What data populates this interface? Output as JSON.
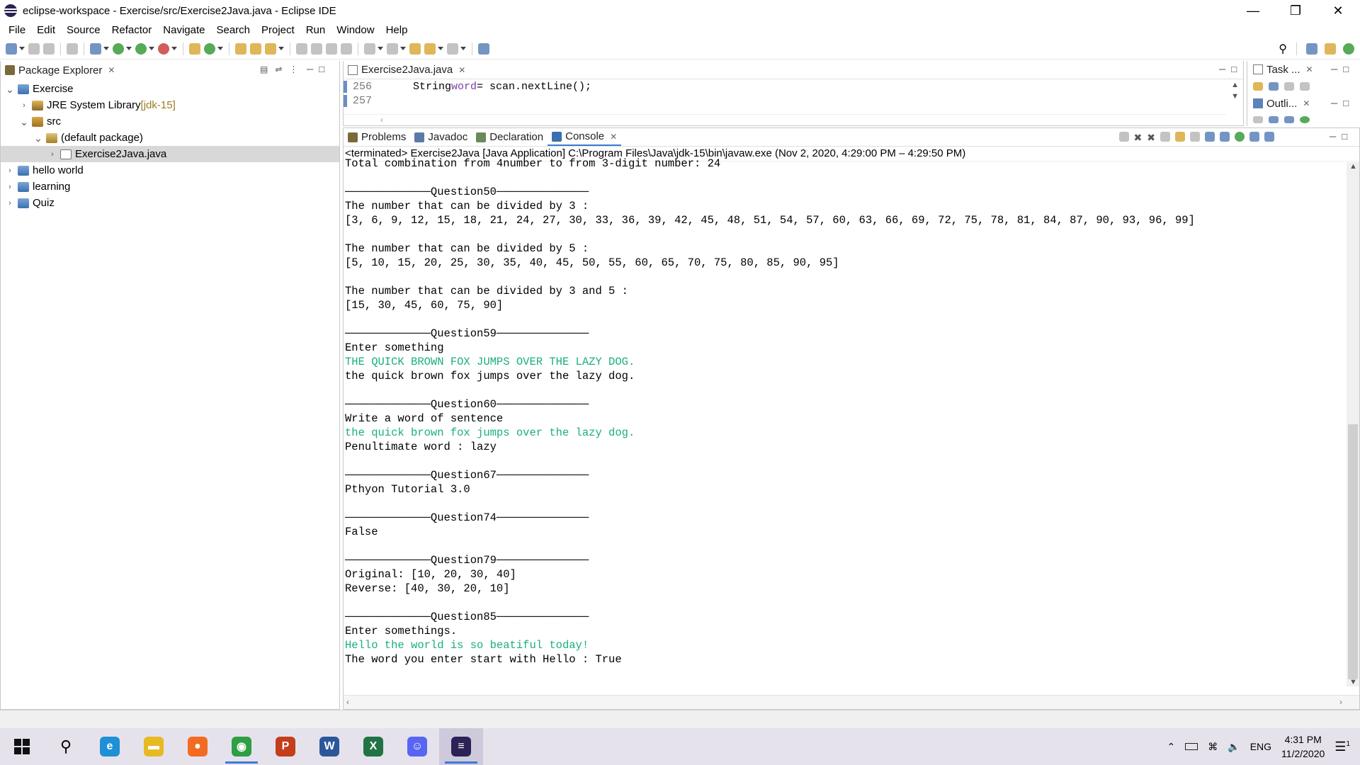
{
  "window": {
    "title": "eclipse-workspace - Exercise/src/Exercise2Java.java - Eclipse IDE"
  },
  "menu": [
    "File",
    "Edit",
    "Source",
    "Refactor",
    "Navigate",
    "Search",
    "Project",
    "Run",
    "Window",
    "Help"
  ],
  "package_explorer": {
    "tab_label": "Package Explorer",
    "nodes": [
      {
        "label": "Exercise",
        "suffix": "",
        "icon": "project-icon",
        "level": 0,
        "expanded": true
      },
      {
        "label": "JRE System Library ",
        "suffix": "[jdk-15]",
        "icon": "library-icon",
        "level": 1,
        "expanded": false
      },
      {
        "label": "src",
        "suffix": "",
        "icon": "source-folder-icon",
        "level": 1,
        "expanded": true
      },
      {
        "label": "(default package)",
        "suffix": "",
        "icon": "package-icon",
        "level": 2,
        "expanded": true
      },
      {
        "label": "Exercise2Java.java",
        "suffix": "",
        "icon": "java-file-icon",
        "level": 3,
        "expanded": false,
        "selected": true
      },
      {
        "label": "hello world",
        "suffix": "",
        "icon": "project-icon",
        "level": 0,
        "expanded": false
      },
      {
        "label": "learning",
        "suffix": "",
        "icon": "project-icon",
        "level": 0,
        "expanded": false
      },
      {
        "label": "Quiz",
        "suffix": "",
        "icon": "project-icon",
        "level": 0,
        "expanded": false
      }
    ]
  },
  "editor": {
    "tab_label": "Exercise2Java.java",
    "lines": [
      {
        "num": "256",
        "type": "String",
        "var": "word",
        "rest": " = scan.nextLine();"
      },
      {
        "num": "257",
        "type": "",
        "var": "",
        "rest": ""
      }
    ]
  },
  "side_views": {
    "task_label": "Task ...",
    "outline_label": "Outli..."
  },
  "bottom_tabs": [
    "Problems",
    "Javadoc",
    "Declaration",
    "Console"
  ],
  "console": {
    "info": "<terminated> Exercise2Java [Java Application] C:\\Program Files\\Java\\jdk-15\\bin\\javaw.exe  (Nov 2, 2020, 4:29:00 PM – 4:29:50 PM)",
    "lines": [
      {
        "t": "Total combination from 4number to from 3-digit number: 24",
        "in": false
      },
      {
        "t": "",
        "in": false
      },
      {
        "t": "─────────────Question50──────────────",
        "in": false
      },
      {
        "t": "The number that can be divided by 3 :",
        "in": false
      },
      {
        "t": "[3, 6, 9, 12, 15, 18, 21, 24, 27, 30, 33, 36, 39, 42, 45, 48, 51, 54, 57, 60, 63, 66, 69, 72, 75, 78, 81, 84, 87, 90, 93, 96, 99]",
        "in": false
      },
      {
        "t": "",
        "in": false
      },
      {
        "t": "The number that can be divided by 5 :",
        "in": false
      },
      {
        "t": "[5, 10, 15, 20, 25, 30, 35, 40, 45, 50, 55, 60, 65, 70, 75, 80, 85, 90, 95]",
        "in": false
      },
      {
        "t": "",
        "in": false
      },
      {
        "t": "The number that can be divided by 3 and 5 :",
        "in": false
      },
      {
        "t": "[15, 30, 45, 60, 75, 90]",
        "in": false
      },
      {
        "t": "",
        "in": false
      },
      {
        "t": "─────────────Question59──────────────",
        "in": false
      },
      {
        "t": "Enter something",
        "in": false
      },
      {
        "t": "THE QUICK BROWN FOX JUMPS OVER THE LAZY DOG.",
        "in": true
      },
      {
        "t": "the quick brown fox jumps over the lazy dog.",
        "in": false
      },
      {
        "t": "",
        "in": false
      },
      {
        "t": "─────────────Question60──────────────",
        "in": false
      },
      {
        "t": "Write a word of sentence",
        "in": false
      },
      {
        "t": "the quick brown fox jumps over the lazy dog.",
        "in": true
      },
      {
        "t": "Penultimate word : lazy",
        "in": false
      },
      {
        "t": "",
        "in": false
      },
      {
        "t": "─────────────Question67──────────────",
        "in": false
      },
      {
        "t": "Pthyon Tutorial 3.0",
        "in": false
      },
      {
        "t": "",
        "in": false
      },
      {
        "t": "─────────────Question74──────────────",
        "in": false
      },
      {
        "t": "False",
        "in": false
      },
      {
        "t": "",
        "in": false
      },
      {
        "t": "─────────────Question79──────────────",
        "in": false
      },
      {
        "t": "Original: [10, 20, 30, 40]",
        "in": false
      },
      {
        "t": "Reverse: [40, 30, 20, 10]",
        "in": false
      },
      {
        "t": "",
        "in": false
      },
      {
        "t": "─────────────Question85──────────────",
        "in": false
      },
      {
        "t": "Enter somethings.",
        "in": false
      },
      {
        "t": "Hello the world is so beatiful today!",
        "in": true
      },
      {
        "t": "The word you enter start with Hello : True",
        "in": false
      }
    ]
  },
  "taskbar": {
    "apps": [
      {
        "name": "edge-icon",
        "glyph": "e",
        "color": "#1f8fd6",
        "running": false
      },
      {
        "name": "file-explorer-icon",
        "glyph": "▬",
        "color": "#e8b923",
        "running": false
      },
      {
        "name": "firefox-icon",
        "glyph": "●",
        "color": "#f36b21",
        "running": false
      },
      {
        "name": "chrome-icon",
        "glyph": "◉",
        "color": "#2f9e44",
        "running": true
      },
      {
        "name": "powerpoint-icon",
        "glyph": "P",
        "color": "#c43e1c",
        "running": false
      },
      {
        "name": "word-icon",
        "glyph": "W",
        "color": "#2b579a",
        "running": false
      },
      {
        "name": "excel-icon",
        "glyph": "X",
        "color": "#217346",
        "running": false
      },
      {
        "name": "discord-icon",
        "glyph": "☺",
        "color": "#5865f2",
        "running": false
      },
      {
        "name": "eclipse-icon",
        "glyph": "≡",
        "color": "#2c2255",
        "running": true,
        "active": true
      }
    ],
    "language": "ENG",
    "time": "4:31 PM",
    "date": "11/2/2020",
    "notification_count": "1"
  }
}
